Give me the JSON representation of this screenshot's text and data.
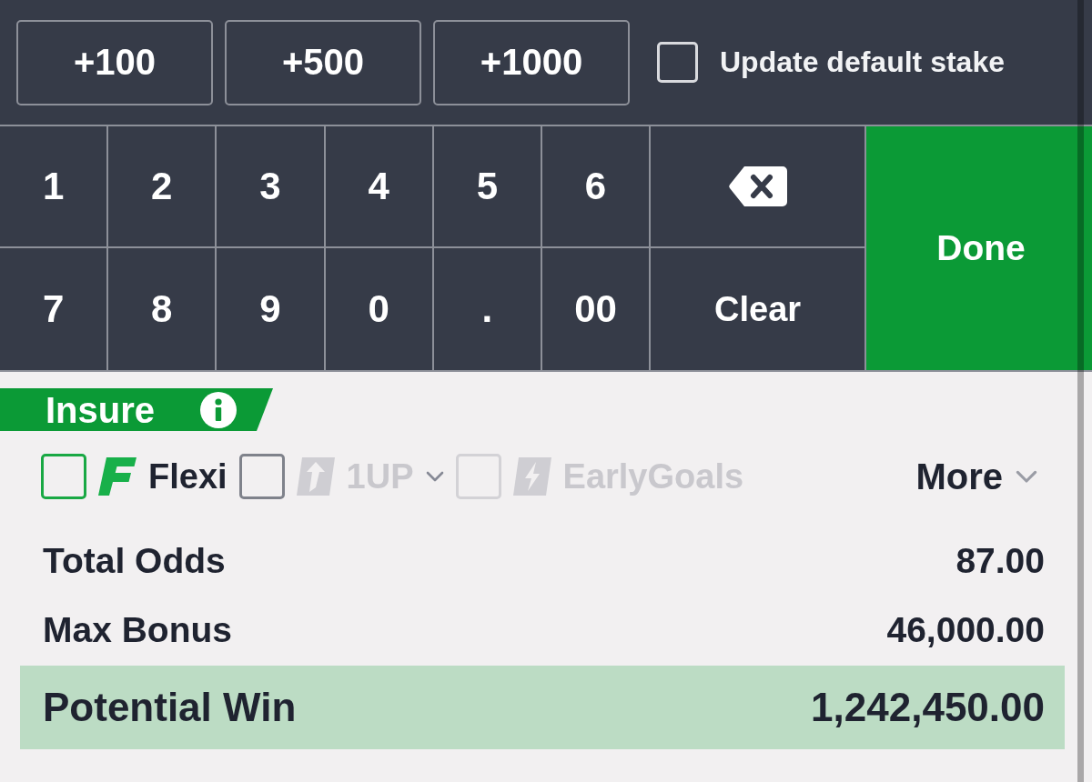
{
  "quick_stakes": [
    "+100",
    "+500",
    "+1000"
  ],
  "default_stake": {
    "label": "Update default stake",
    "checked": false
  },
  "keypad": {
    "keys": [
      {
        "kind": "digit",
        "label": "1"
      },
      {
        "kind": "digit",
        "label": "2"
      },
      {
        "kind": "digit",
        "label": "3"
      },
      {
        "kind": "digit",
        "label": "4"
      },
      {
        "kind": "digit",
        "label": "5"
      },
      {
        "kind": "digit",
        "label": "6"
      },
      {
        "kind": "backspace"
      },
      {
        "kind": "digit",
        "label": "7"
      },
      {
        "kind": "digit",
        "label": "8"
      },
      {
        "kind": "digit",
        "label": "9"
      },
      {
        "kind": "digit",
        "label": "0"
      },
      {
        "kind": "digit",
        "label": "."
      },
      {
        "kind": "digit",
        "label": "00"
      },
      {
        "kind": "clear",
        "label": "Clear"
      }
    ],
    "done": "Done"
  },
  "insure": {
    "label": "Insure"
  },
  "bet_options": [
    {
      "kind": "flexi",
      "label": "Flexi",
      "checked": false,
      "disabled": false,
      "has_dropdown": false
    },
    {
      "kind": "oneup",
      "label": "1UP",
      "checked": false,
      "disabled": true,
      "has_dropdown": true
    },
    {
      "kind": "earlygoals",
      "label": "EarlyGoals",
      "checked": false,
      "disabled": true,
      "has_dropdown": false
    }
  ],
  "more": "More",
  "summary": [
    {
      "label": "Total Odds",
      "value": "87.00",
      "highlighted": false
    },
    {
      "label": "Max Bonus",
      "value": "46,000.00",
      "highlighted": false
    },
    {
      "label": "Potential Win",
      "value": "1,242,450.00",
      "highlighted": true
    }
  ]
}
